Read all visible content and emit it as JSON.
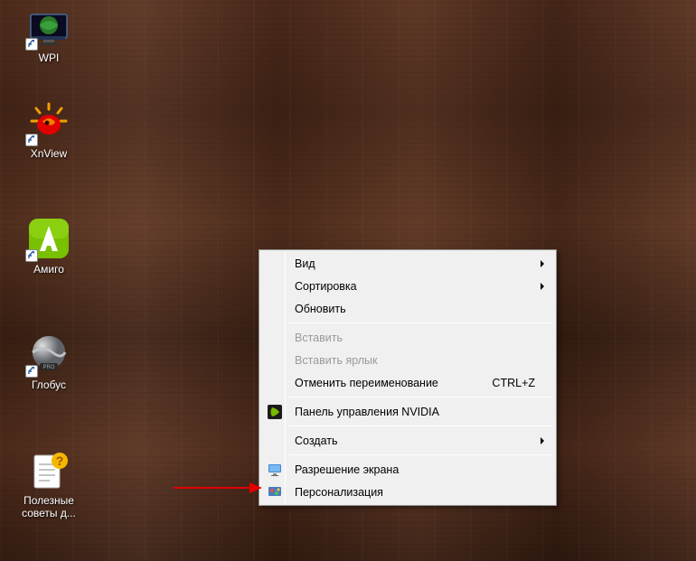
{
  "desktop": {
    "icons": [
      {
        "label": "WPI"
      },
      {
        "label": "XnView"
      },
      {
        "label": "Амиго"
      },
      {
        "label": "Глобус"
      },
      {
        "label": "Полезные советы д..."
      }
    ]
  },
  "context_menu": {
    "items": [
      {
        "label": "Вид",
        "submenu": true
      },
      {
        "label": "Сортировка",
        "submenu": true
      },
      {
        "label": "Обновить"
      },
      {
        "sep": true
      },
      {
        "label": "Вставить",
        "disabled": true
      },
      {
        "label": "Вставить ярлык",
        "disabled": true
      },
      {
        "label": "Отменить переименование",
        "shortcut": "CTRL+Z"
      },
      {
        "sep": true
      },
      {
        "label": "Панель управления NVIDIA",
        "icon": "nvidia"
      },
      {
        "sep": true
      },
      {
        "label": "Создать",
        "submenu": true
      },
      {
        "sep": true
      },
      {
        "label": "Разрешение экрана",
        "icon": "monitor"
      },
      {
        "label": "Персонализация",
        "icon": "personalize"
      }
    ]
  }
}
